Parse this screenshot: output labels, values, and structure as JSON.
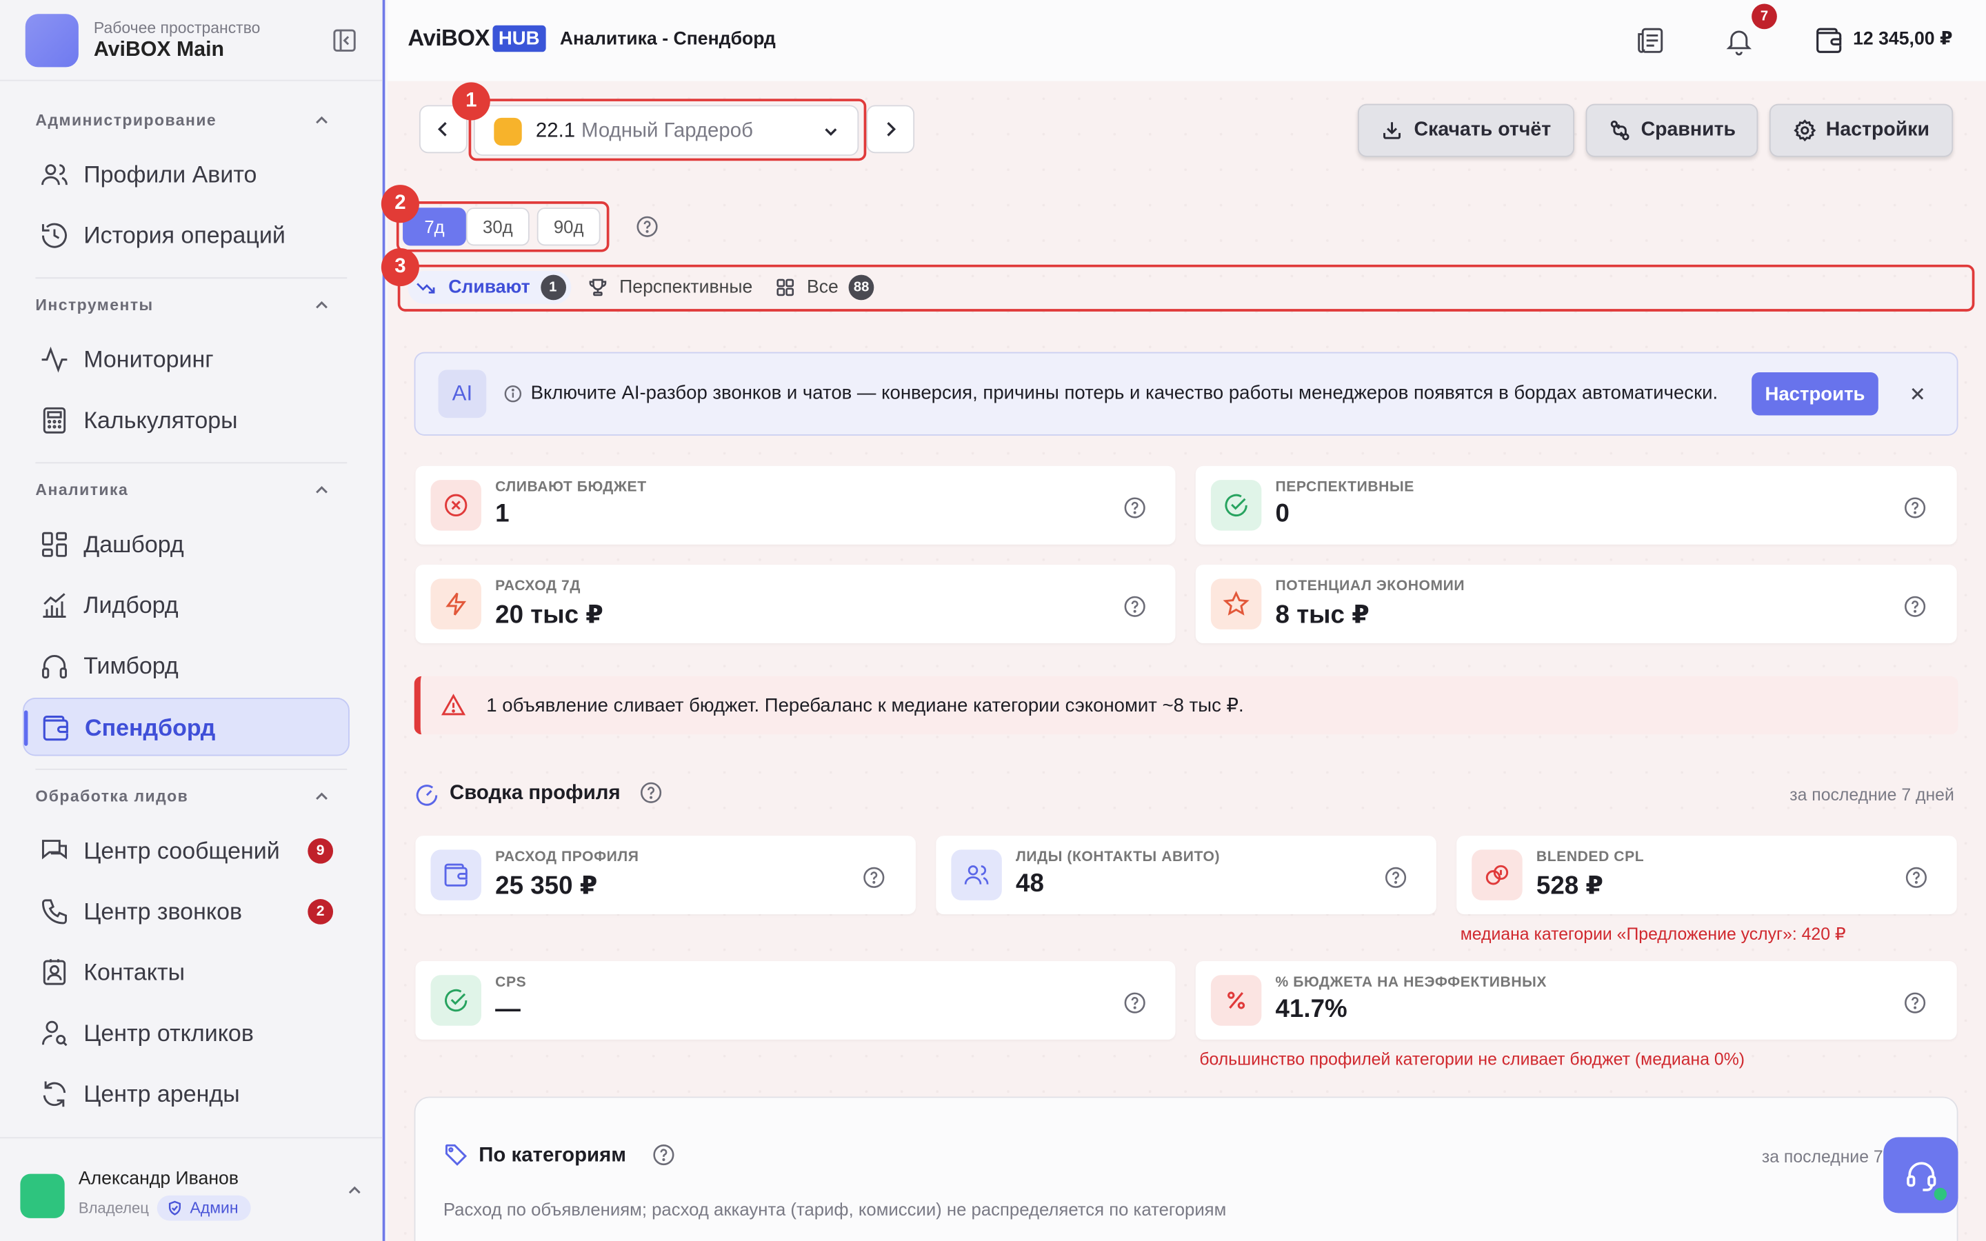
{
  "workspace": {
    "subtitle": "Рабочее пространство",
    "name": "AviBOX Main"
  },
  "sidebar": {
    "sections": [
      {
        "title": "Администрирование",
        "items": [
          {
            "label": "Профили Авито",
            "icon": "users-icon"
          },
          {
            "label": "История операций",
            "icon": "history-icon"
          }
        ]
      },
      {
        "title": "Инструменты",
        "items": [
          {
            "label": "Мониторинг",
            "icon": "activity-icon"
          },
          {
            "label": "Калькуляторы",
            "icon": "calculator-icon"
          }
        ]
      },
      {
        "title": "Аналитика",
        "items": [
          {
            "label": "Дашборд",
            "icon": "dashboard-icon"
          },
          {
            "label": "Лидборд",
            "icon": "chart-icon"
          },
          {
            "label": "Тимборд",
            "icon": "headphones-icon"
          },
          {
            "label": "Спендборд",
            "icon": "wallet-icon",
            "active": true
          }
        ]
      },
      {
        "title": "Обработка лидов",
        "items": [
          {
            "label": "Центр сообщений",
            "icon": "messages-icon",
            "badge": "9"
          },
          {
            "label": "Центр звонков",
            "icon": "phone-icon",
            "badge": "2"
          },
          {
            "label": "Контакты",
            "icon": "contacts-icon"
          },
          {
            "label": "Центр откликов",
            "icon": "user-search-icon"
          },
          {
            "label": "Центр аренды",
            "icon": "refresh-icon"
          }
        ]
      }
    ]
  },
  "user": {
    "name": "Александр Иванов",
    "role": "Владелец",
    "badge": "Админ"
  },
  "topbar": {
    "brand": "AviBOX",
    "brand_hub": "HUB",
    "title": "Аналитика - Спендборд",
    "notifications_count": "7",
    "balance": "12 345,00 ₽"
  },
  "toolbar": {
    "profile_number": "22.1",
    "profile_name": "Модный Гардероб",
    "download_label": "Скачать отчёт",
    "compare_label": "Сравнить",
    "settings_label": "Настройки"
  },
  "highlights": [
    "1",
    "2",
    "3"
  ],
  "periods": [
    "7д",
    "30д",
    "90д"
  ],
  "tabs": [
    {
      "label": "Сливают",
      "badge": "1"
    },
    {
      "label": "Перспективные"
    },
    {
      "label": "Все",
      "badge": "88"
    }
  ],
  "ai_banner": {
    "icon_text": "AI",
    "text": "Включите AI-разбор звонков и чатов — конверсия, причины потерь и качество работы менеджеров появятся в бордах автоматически.",
    "button": "Настроить"
  },
  "kpis": [
    {
      "label": "СЛИВАЮТ БЮДЖЕТ",
      "value": "1"
    },
    {
      "label": "ПЕРСПЕКТИВНЫЕ",
      "value": "0"
    },
    {
      "label": "РАСХОД 7Д",
      "value": "20 тыс ₽"
    },
    {
      "label": "ПОТЕНЦИАЛ ЭКОНОМИИ",
      "value": "8 тыс ₽"
    }
  ],
  "alert": {
    "text": "1 объявление сливает бюджет. Перебаланс к медиане категории сэкономит ~8 тыс ₽."
  },
  "summary": {
    "title": "Сводка профиля",
    "period": "за последние 7 дней",
    "cards": [
      {
        "label": "РАСХОД ПРОФИЛЯ",
        "value": "25 350 ₽"
      },
      {
        "label": "ЛИДЫ (КОНТАКТЫ АВИТО)",
        "value": "48"
      },
      {
        "label": "BLENDED CPL",
        "value": "528 ₽"
      },
      {
        "label": "CPS",
        "value": "—"
      },
      {
        "label": "% БЮДЖЕТА НА НЕЭФФЕКТИВНЫХ",
        "value": "41.7%"
      }
    ],
    "cpl_note": "медиана категории «Предложение услуг»: 420 ₽",
    "ineff_note": "большинство профилей категории не сливает бюджет (медиана 0%)"
  },
  "categories": {
    "title": "По категориям",
    "period": "за последние 7",
    "subtitle": "Расход по объявлениям; расход аккаунта (тариф, комиссии) не распределяется по категориям"
  }
}
